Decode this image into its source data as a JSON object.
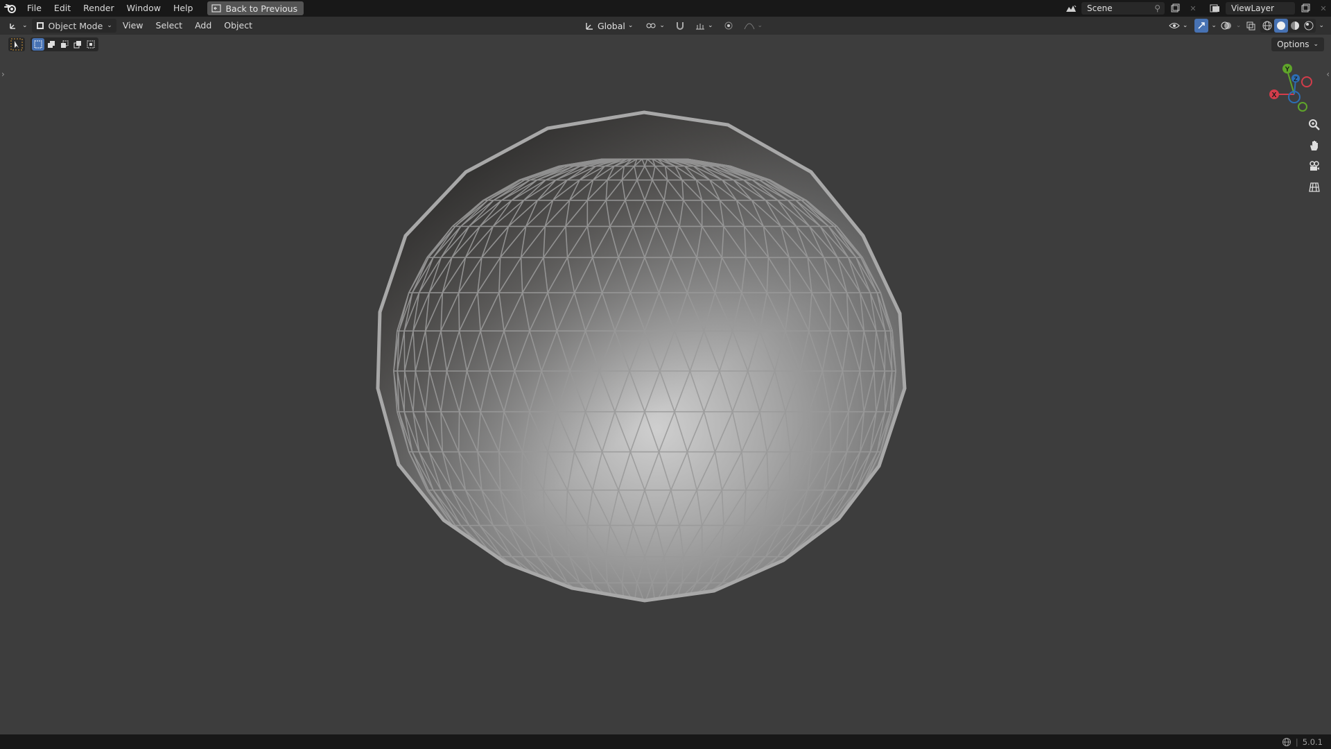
{
  "menubar": {
    "logo": "blender-logo-icon",
    "items": [
      "File",
      "Edit",
      "Render",
      "Window",
      "Help"
    ],
    "back_button_label": "Back to Previous",
    "scene_name": "Scene",
    "view_layer_name": "ViewLayer"
  },
  "header": {
    "mode_label": "Object Mode",
    "menus": [
      "View",
      "Select",
      "Add",
      "Object"
    ],
    "transform_orientation": "Global"
  },
  "toolbar": {
    "options_label": "Options"
  },
  "gizmo": {
    "y_label": "Y",
    "z_label": "Z",
    "x_label": "X"
  },
  "statusbar": {
    "version": "5.0.1"
  },
  "colors": {
    "accent": "#4772b3",
    "axis_x": "#d33d4b",
    "axis_y": "#5fa52a",
    "axis_z": "#2c6eb5"
  }
}
